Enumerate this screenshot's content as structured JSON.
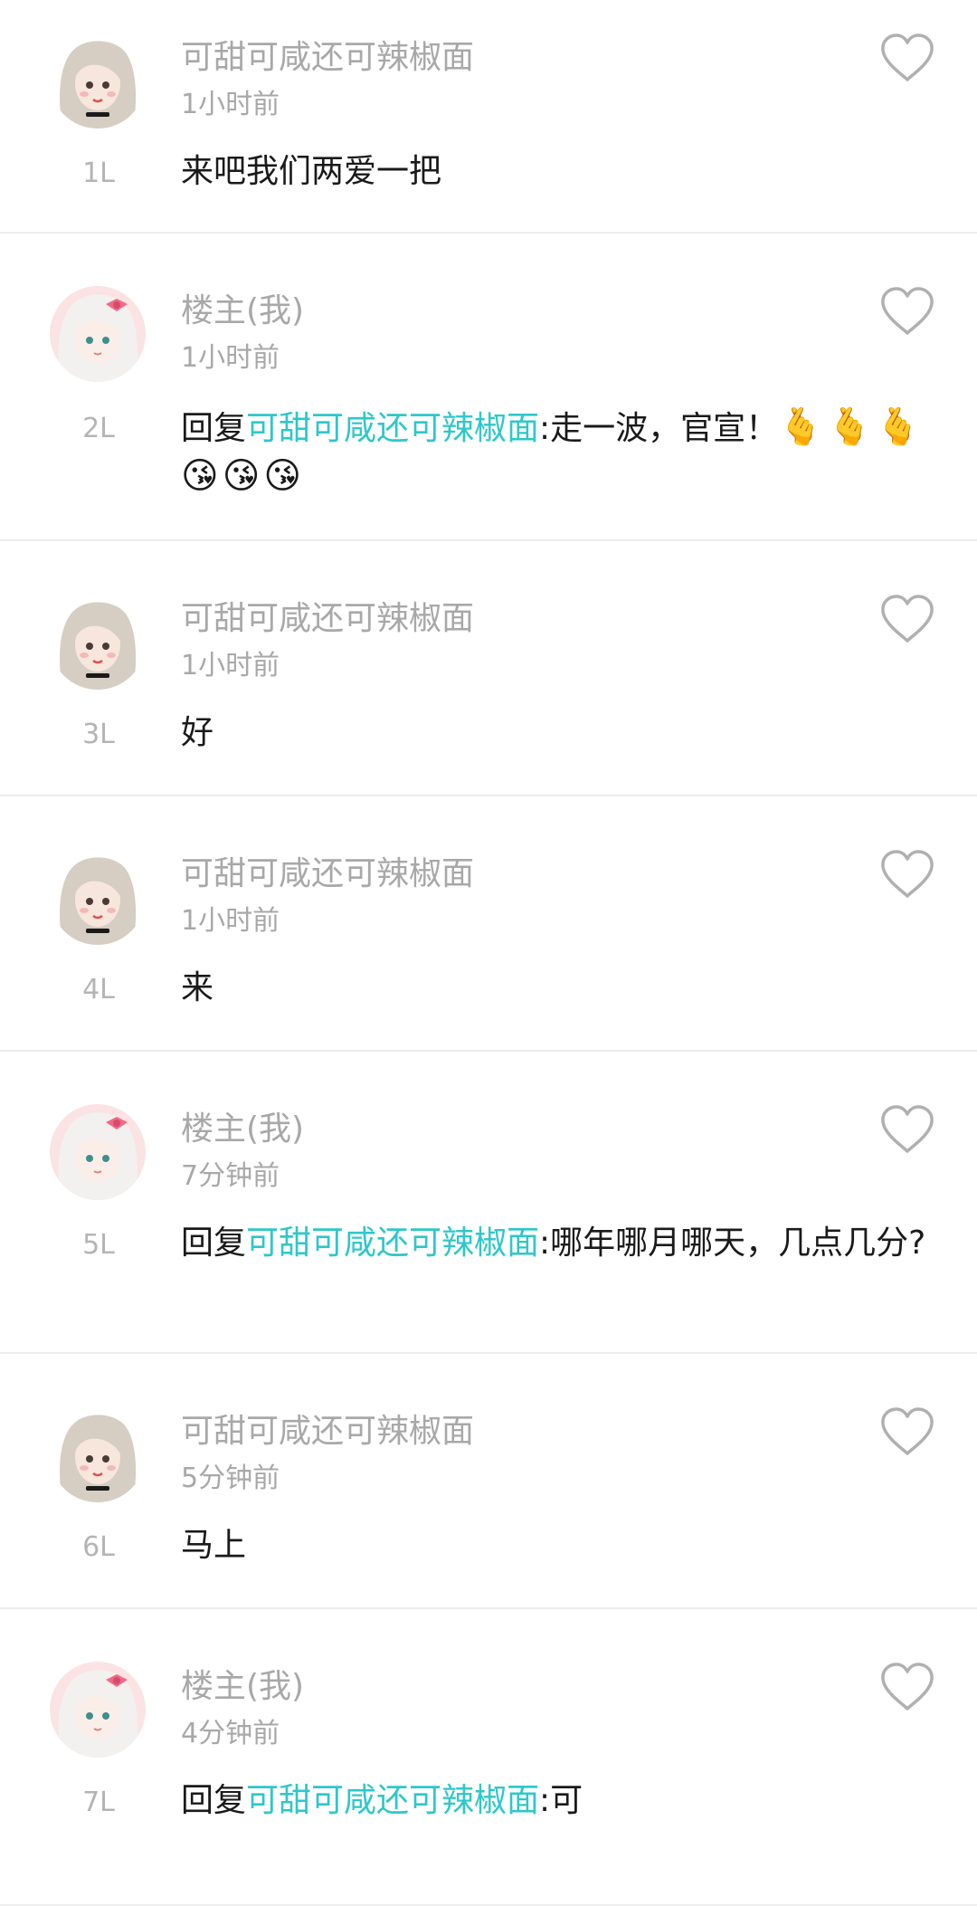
{
  "comments": [
    {
      "floor": "1L",
      "username": "可甜可咸还可辣椒面",
      "time": "1小时前",
      "avatar": "girl-avatar",
      "is_reply": false,
      "text": "来吧我们两爱一把",
      "emoji": ""
    },
    {
      "floor": "2L",
      "username": "楼主(我)",
      "time": "1小时前",
      "avatar": "owner-avatar",
      "is_reply": true,
      "reply_prefix": "回复",
      "mention": "可甜可咸还可辣椒面",
      "text": ":走一波，官宣！",
      "emoji": "🫰🫰🫰😘😘😘"
    },
    {
      "floor": "3L",
      "username": "可甜可咸还可辣椒面",
      "time": "1小时前",
      "avatar": "girl-avatar",
      "is_reply": false,
      "text": "好",
      "emoji": ""
    },
    {
      "floor": "4L",
      "username": "可甜可咸还可辣椒面",
      "time": "1小时前",
      "avatar": "girl-avatar",
      "is_reply": false,
      "text": "来",
      "emoji": ""
    },
    {
      "floor": "5L",
      "username": "楼主(我)",
      "time": "7分钟前",
      "avatar": "owner-avatar",
      "is_reply": true,
      "reply_prefix": "回复",
      "mention": "可甜可咸还可辣椒面",
      "text": ":哪年哪月哪天，几点几分?",
      "emoji": ""
    },
    {
      "floor": "6L",
      "username": "可甜可咸还可辣椒面",
      "time": "5分钟前",
      "avatar": "girl-avatar",
      "is_reply": false,
      "text": "马上",
      "emoji": ""
    },
    {
      "floor": "7L",
      "username": "楼主(我)",
      "time": "4分钟前",
      "avatar": "owner-avatar",
      "is_reply": true,
      "reply_prefix": "回复",
      "mention": "可甜可咸还可辣椒面",
      "text": ":可",
      "emoji": ""
    }
  ],
  "icons": {
    "like": "heart-outline-icon"
  },
  "colors": {
    "mention": "#2ec7c9",
    "meta_text": "#a8a8a8",
    "body_text": "#1a1a1a",
    "divider": "#ececec",
    "heart_stroke": "#b0b0b0"
  }
}
